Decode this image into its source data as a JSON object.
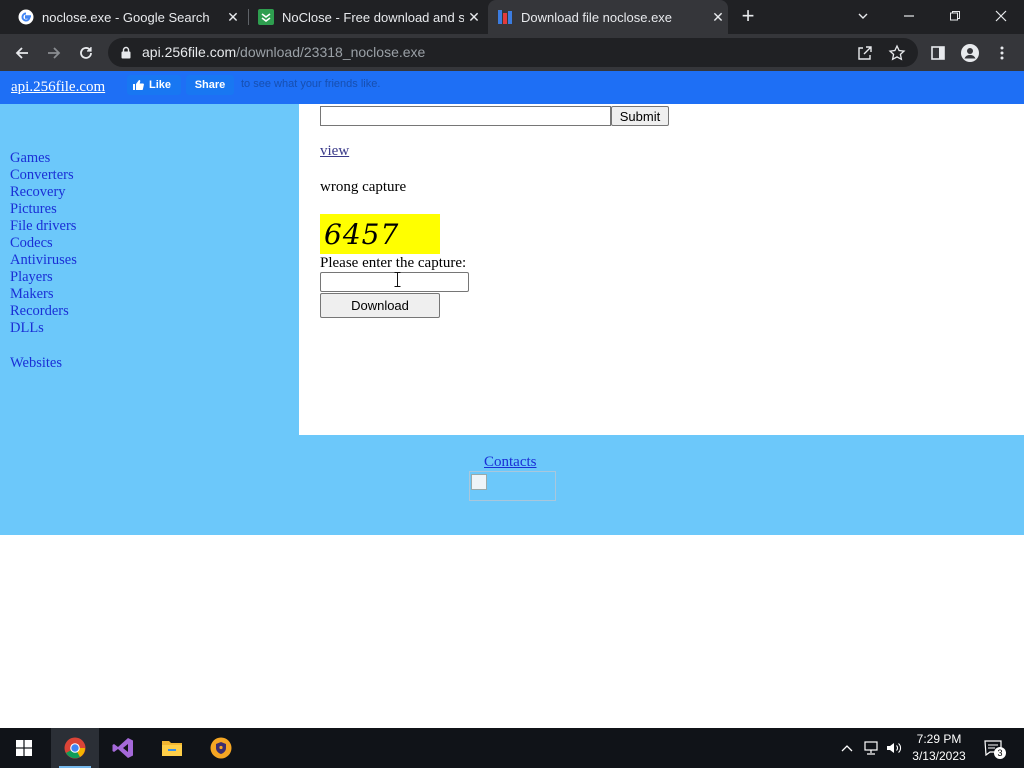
{
  "browser": {
    "tabs": [
      {
        "title": "noclose.exe - Google Search",
        "icon": "google-icon"
      },
      {
        "title": "NoClose - Free download and so",
        "icon": "download-site-icon"
      },
      {
        "title": "Download file noclose.exe",
        "icon": "site-favicon-icon"
      }
    ],
    "url_host": "api.256file.com",
    "url_path": "/download/23318_noclose.exe"
  },
  "page": {
    "site_link": "api.256file.com",
    "fb_like": "Like",
    "fb_share": "Share",
    "fb_text": "to see what your friends like.",
    "sidebar_items": [
      "Games",
      "Converters",
      "Recovery",
      "Pictures",
      "File drivers",
      "Codecs",
      "Antiviruses",
      "Players",
      "Makers",
      "Recorders",
      "DLLs"
    ],
    "websites_link": "Websites",
    "submit_label": "Submit",
    "view_link": "view",
    "wrong_capture": "wrong capture",
    "captcha_code": "6457",
    "prompt": "Please enter the capture:",
    "download_label": "Download",
    "contacts_link": "Contacts"
  },
  "taskbar": {
    "time": "7:29 PM",
    "date": "3/13/2023",
    "notifications": "3"
  }
}
